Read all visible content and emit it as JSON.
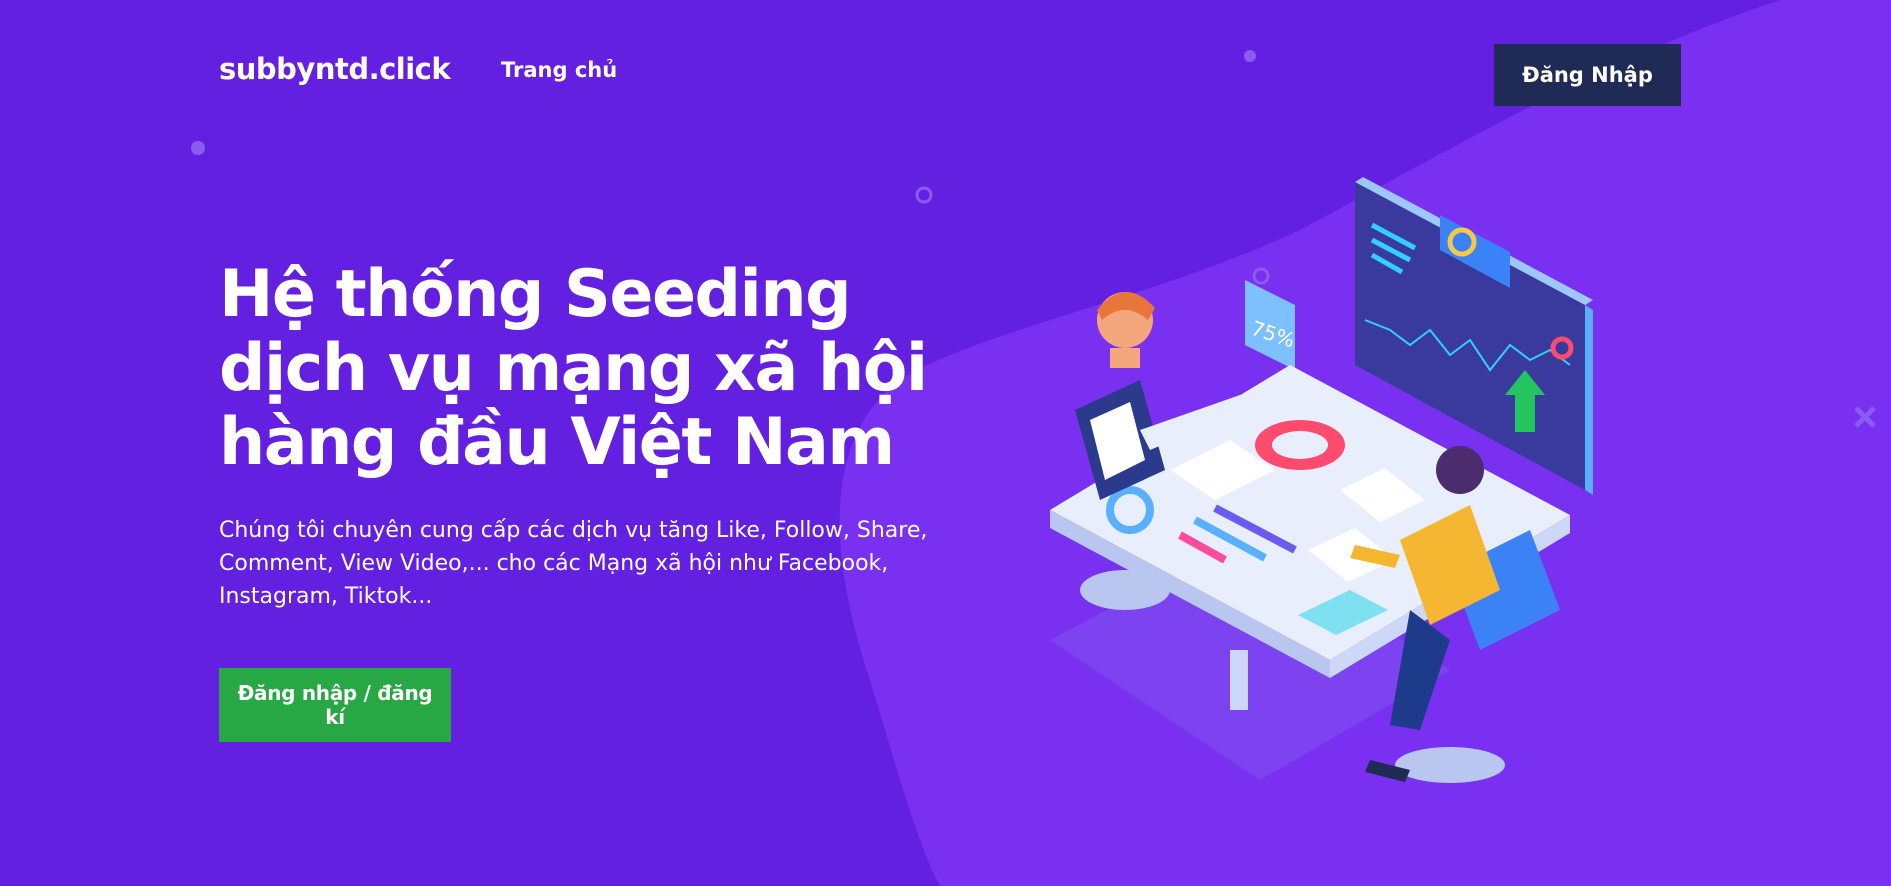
{
  "header": {
    "brand": "subbyntd.click",
    "nav_home": "Trang chủ",
    "login_label": "Đăng Nhập"
  },
  "hero": {
    "title_lines": [
      "Hệ thống Seeding",
      "dịch vụ mạng xã hội",
      "hàng đầu Việt Nam"
    ],
    "desc_lines": [
      "Chúng tôi chuyên cung cấp các dịch vụ tăng Like, Follow, Share,",
      "Comment, View Video,... cho các Mạng xã hội như Facebook,",
      "Instagram, Tiktok..."
    ],
    "cta_label": "Đăng nhập / đăng kí"
  },
  "illustration": {
    "badge_text": "75%",
    "colors": {
      "background": "#6420e0",
      "blob": "#7a30f0",
      "login_button": "#1f2a55",
      "cta_button": "#28a745"
    }
  }
}
